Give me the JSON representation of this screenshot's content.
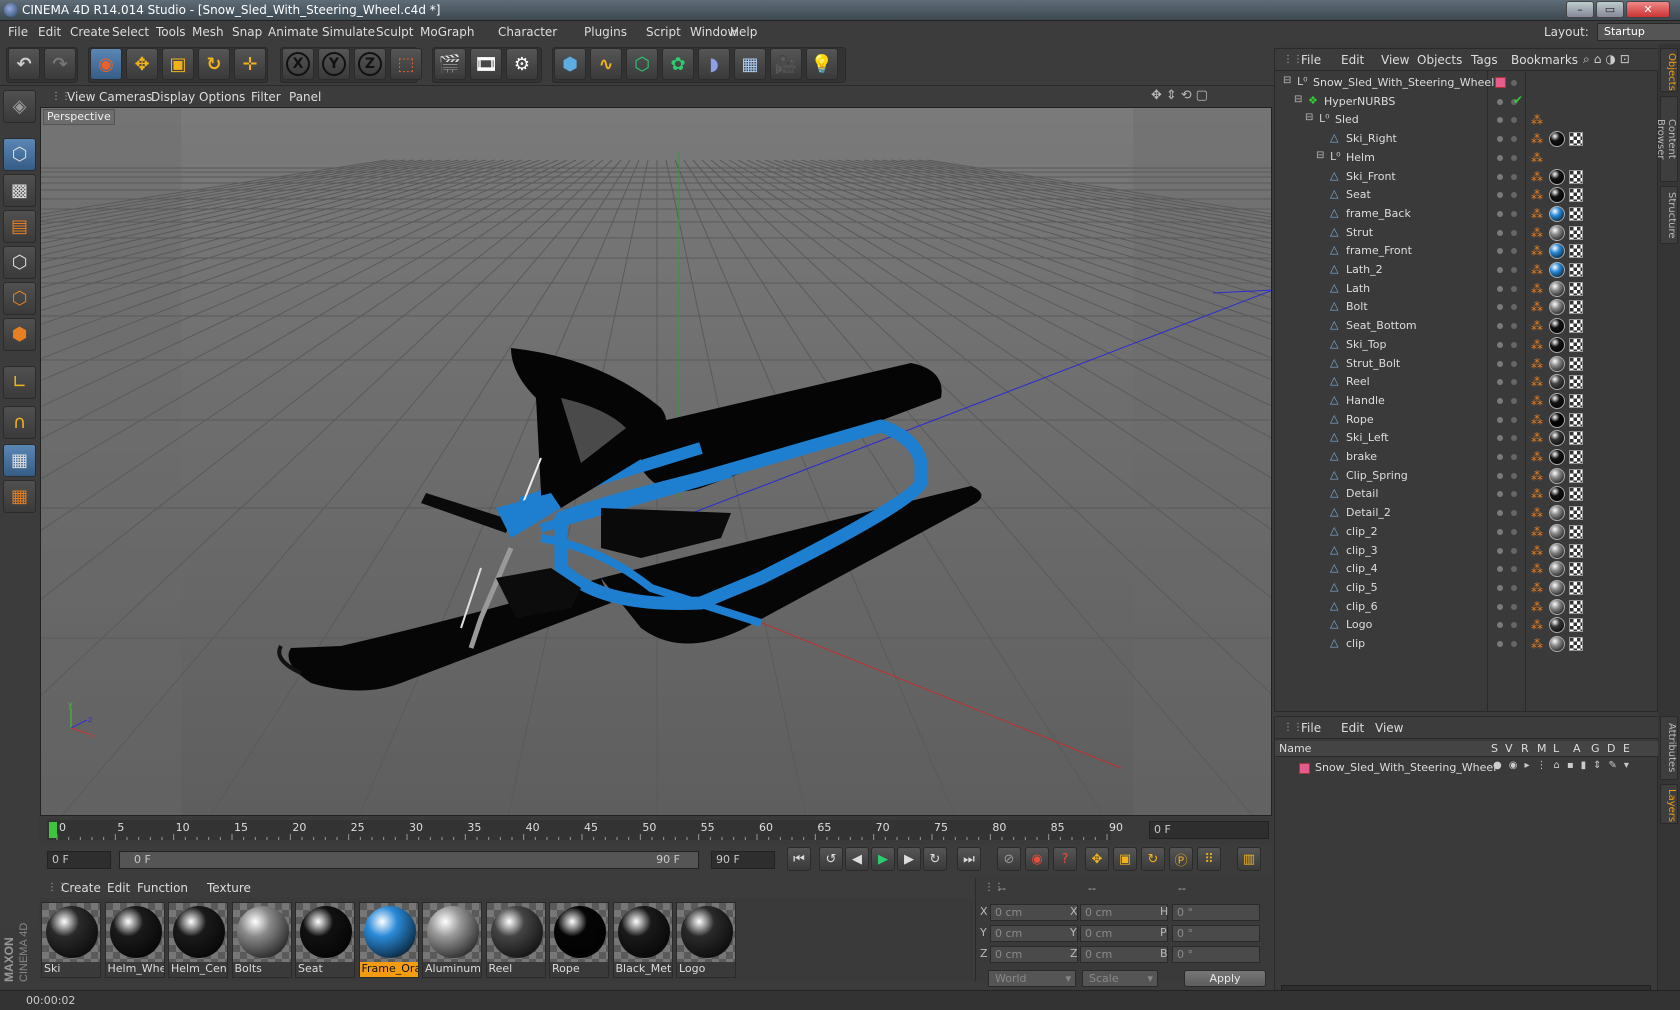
{
  "window": {
    "title": "CINEMA 4D R14.014 Studio - [Snow_Sled_With_Steering_Wheel.c4d *]"
  },
  "menu": [
    "File",
    "Edit",
    "Create",
    "Select",
    "Tools",
    "Mesh",
    "Snap",
    "Animate",
    "Simulate",
    "Sculpt",
    "MoGraph",
    "Character",
    "Plugins",
    "Script",
    "Window",
    "Help"
  ],
  "layout": {
    "label": "Layout:",
    "value": "Startup"
  },
  "toolbar": {
    "axis": [
      "X",
      "Y",
      "Z"
    ]
  },
  "viewport": {
    "menu": [
      "View",
      "Cameras",
      "Display",
      "Options",
      "Filter",
      "Panel"
    ],
    "label": "Perspective",
    "axis_labels": {
      "x": "x",
      "y": "y",
      "z": "z"
    }
  },
  "timeline": {
    "ticks": [
      "0",
      "5",
      "10",
      "15",
      "20",
      "25",
      "30",
      "35",
      "40",
      "45",
      "50",
      "55",
      "60",
      "65",
      "70",
      "75",
      "80",
      "85",
      "90"
    ],
    "current_frame": "0 F"
  },
  "transport": {
    "start": "0 F",
    "range_start": "0 F",
    "range_end": "90 F",
    "end": "90 F"
  },
  "materials": {
    "menu": [
      "Create",
      "Edit",
      "Function",
      "Texture"
    ],
    "items": [
      {
        "name": "Ski",
        "color": "#2a2a2a"
      },
      {
        "name": "Helm_Whe",
        "color": "#1a1a1a"
      },
      {
        "name": "Helm_Cent",
        "color": "#1a1a1a"
      },
      {
        "name": "Bolts",
        "color": "#8a8a8a"
      },
      {
        "name": "Seat",
        "color": "#111111"
      },
      {
        "name": "Frame_Ora",
        "color": "#2a8ad8"
      },
      {
        "name": "Aluminum",
        "color": "#999999"
      },
      {
        "name": "Reel",
        "color": "#444444"
      },
      {
        "name": "Rope",
        "color": "#050505"
      },
      {
        "name": "Black_Meta",
        "color": "#1a1a1a"
      },
      {
        "name": "Logo",
        "color": "#2a2a2a"
      }
    ]
  },
  "coords": {
    "headers": [
      "--",
      "--",
      "--"
    ],
    "rows": [
      {
        "axis": "X",
        "pos": "0 cm",
        "axis2": "X",
        "size": "0 cm",
        "axis3": "H",
        "rot": "0 °"
      },
      {
        "axis": "Y",
        "pos": "0 cm",
        "axis2": "Y",
        "size": "0 cm",
        "axis3": "P",
        "rot": "0 °"
      },
      {
        "axis": "Z",
        "pos": "0 cm",
        "axis2": "Z",
        "size": "0 cm",
        "axis3": "B",
        "rot": "0 °"
      }
    ],
    "mode": "World",
    "scale": "Scale",
    "apply": "Apply"
  },
  "status": {
    "time": "00:00:02"
  },
  "objects": {
    "menu": [
      "File",
      "Edit",
      "View",
      "Objects",
      "Tags",
      "Bookmarks"
    ],
    "tree": [
      {
        "name": "Snow_Sled_With_Steering_Wheel",
        "indent": 0,
        "type": "null"
      },
      {
        "name": "HyperNURBS",
        "indent": 1,
        "type": "nurbs"
      },
      {
        "name": "Sled",
        "indent": 2,
        "type": "null"
      },
      {
        "name": "Ski_Right",
        "indent": 3,
        "type": "poly",
        "mat": "#111"
      },
      {
        "name": "Helm",
        "indent": 3,
        "type": "null"
      },
      {
        "name": "Ski_Front",
        "indent": 3,
        "type": "poly",
        "mat": "#111"
      },
      {
        "name": "Seat",
        "indent": 3,
        "type": "poly",
        "mat": "#111"
      },
      {
        "name": "frame_Back",
        "indent": 3,
        "type": "poly",
        "mat": "#2a8ad8"
      },
      {
        "name": "Strut",
        "indent": 3,
        "type": "poly",
        "mat": "#888"
      },
      {
        "name": "frame_Front",
        "indent": 3,
        "type": "poly",
        "mat": "#2a8ad8"
      },
      {
        "name": "Lath_2",
        "indent": 3,
        "type": "poly",
        "mat": "#2a8ad8"
      },
      {
        "name": "Lath",
        "indent": 3,
        "type": "poly",
        "mat": "#888"
      },
      {
        "name": "Bolt",
        "indent": 3,
        "type": "poly",
        "mat": "#888"
      },
      {
        "name": "Seat_Bottom",
        "indent": 3,
        "type": "poly",
        "mat": "#111"
      },
      {
        "name": "Ski_Top",
        "indent": 3,
        "type": "poly",
        "mat": "#111"
      },
      {
        "name": "Strut_Bolt",
        "indent": 3,
        "type": "poly",
        "mat": "#888"
      },
      {
        "name": "Reel",
        "indent": 3,
        "type": "poly",
        "mat": "#444"
      },
      {
        "name": "Handle",
        "indent": 3,
        "type": "poly",
        "mat": "#111"
      },
      {
        "name": "Rope",
        "indent": 3,
        "type": "poly",
        "mat": "#050505"
      },
      {
        "name": "Ski_Left",
        "indent": 3,
        "type": "poly",
        "mat": "#333"
      },
      {
        "name": "brake",
        "indent": 3,
        "type": "poly",
        "mat": "#111"
      },
      {
        "name": "Clip_Spring",
        "indent": 3,
        "type": "poly",
        "mat": "#888"
      },
      {
        "name": "Detail",
        "indent": 3,
        "type": "poly",
        "mat": "#111"
      },
      {
        "name": "Detail_2",
        "indent": 3,
        "type": "poly",
        "mat": "#888"
      },
      {
        "name": "clip_2",
        "indent": 3,
        "type": "poly",
        "mat": "#888"
      },
      {
        "name": "clip_3",
        "indent": 3,
        "type": "poly",
        "mat": "#888"
      },
      {
        "name": "clip_4",
        "indent": 3,
        "type": "poly",
        "mat": "#888"
      },
      {
        "name": "clip_5",
        "indent": 3,
        "type": "poly",
        "mat": "#888"
      },
      {
        "name": "clip_6",
        "indent": 3,
        "type": "poly",
        "mat": "#888"
      },
      {
        "name": "Logo",
        "indent": 3,
        "type": "poly",
        "mat": "#333"
      },
      {
        "name": "clip",
        "indent": 3,
        "type": "poly",
        "mat": "#888"
      }
    ]
  },
  "layers": {
    "menu": [
      "File",
      "Edit",
      "View"
    ],
    "headers": [
      "Name",
      "S",
      "V",
      "R",
      "M",
      "L",
      "A",
      "G",
      "D",
      "E"
    ],
    "rows": [
      {
        "name": "Snow_Sled_With_Steering_Wheel",
        "color": "#e45c8c"
      }
    ]
  },
  "sidetabs": [
    "Objects",
    "Content Browser",
    "Structure",
    "Attributes",
    "Layers"
  ]
}
